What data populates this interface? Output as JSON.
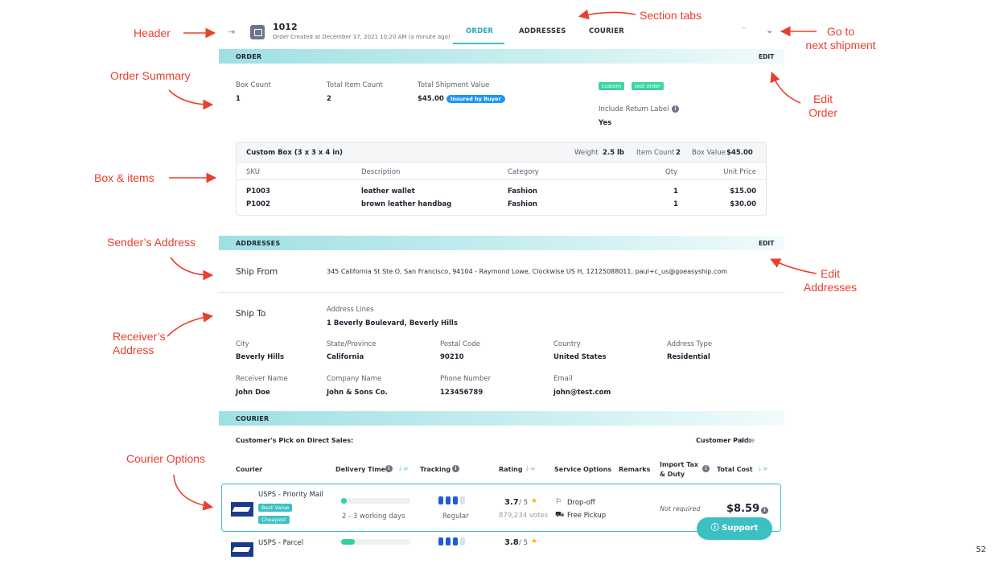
{
  "annotations": {
    "header": "Header",
    "section_tabs": "Section tabs",
    "go_next": [
      "Go to",
      "next shipment"
    ],
    "order_summary": "Order Summary",
    "edit_order": [
      "Edit",
      "Order"
    ],
    "box_items": "Box & items",
    "sender_address": "Sender’s Address",
    "edit_addresses": [
      "Edit",
      "Addresses"
    ],
    "receiver_address": [
      "Receiver’s",
      "Address"
    ],
    "courier_options": "Courier Options"
  },
  "header": {
    "collapse_icon": "collapse-icon",
    "box_icon": "box-icon",
    "shipment_id": "1012",
    "created": "Order Created at December 17, 2021 10:20 AM (a minute ago)",
    "tabs": [
      "ORDER",
      "ADDRESSES",
      "COURIER"
    ],
    "active_tab": "ORDER",
    "prev_icon": "chevron-up-icon",
    "next_icon": "chevron-down-icon"
  },
  "order": {
    "section_title": "ORDER",
    "edit_label": "EDIT",
    "box_count_label": "Box Count",
    "box_count": "1",
    "total_item_count_label": "Total Item Count",
    "total_item_count": "2",
    "total_value_label": "Total Shipment Value",
    "total_value": "$45.00",
    "insured_badge": "Insured by Buyer",
    "tags": [
      "custom",
      "test order"
    ],
    "return_label_label": "Include Return Label",
    "return_label": "Yes",
    "box": {
      "name": "Custom Box (3 x 3 x 4 in)",
      "weight_label": "Weight",
      "weight": "2.5 lb",
      "item_count_label": "Item Count",
      "item_count": "2",
      "box_value_label": "Box Value",
      "box_value": "$45.00",
      "columns": [
        "SKU",
        "Description",
        "Category",
        "Qty",
        "Unit Price"
      ],
      "rows": [
        [
          "P1003",
          "leather wallet",
          "Fashion",
          "1",
          "$15.00"
        ],
        [
          "P1002",
          "brown leather handbag",
          "Fashion",
          "1",
          "$30.00"
        ]
      ]
    }
  },
  "addresses": {
    "section_title": "ADDRESSES",
    "edit_label": "EDIT",
    "ship_from_label": "Ship From",
    "ship_from": "345 California St Ste O, San Francisco, 94104 - Raymond Lowe, Clockwise US H, 12125088011, paul+c_us@goeasyship.com",
    "ship_to_label": "Ship To",
    "address_lines_label": "Address Lines",
    "address_lines": "1 Beverly Boulevard, Beverly Hills",
    "fields": [
      {
        "label": "City",
        "value": "Beverly Hills"
      },
      {
        "label": "State/Province",
        "value": "California"
      },
      {
        "label": "Postal Code",
        "value": "90210"
      },
      {
        "label": "Country",
        "value": "United States"
      },
      {
        "label": "Address Type",
        "value": "Residential"
      },
      {
        "label": "Receiver Name",
        "value": "John Doe"
      },
      {
        "label": "Company Name",
        "value": "John & Sons Co."
      },
      {
        "label": "Phone Number",
        "value": "123456789"
      },
      {
        "label": "Email",
        "value": "john@test.com"
      }
    ]
  },
  "courier": {
    "section_title": "COURIER",
    "pick_label": "Customer's Pick on Direct Sales:",
    "paid_label": "Customer Paid:",
    "paid_value": "Free",
    "columns": {
      "courier": "Courier",
      "delivery_time": "Delivery Time",
      "tracking": "Tracking",
      "rating": "Rating",
      "service_options": "Service Options",
      "remarks": "Remarks",
      "import_tax_1": "Import Tax",
      "import_tax_2": "& Duty",
      "total_cost": "Total Cost"
    },
    "options": [
      {
        "name": "USPS - Priority Mail",
        "tags": [
          "Best Value",
          "Cheapest"
        ],
        "delivery": "2 - 3 working days",
        "delivery_fraction": 0.08,
        "tracking": "Regular",
        "tracking_level": 3,
        "rating": "3.7",
        "rating_max": "/ 5",
        "votes": "879,234 votes",
        "services": [
          "Drop-off",
          "Free Pickup"
        ],
        "import_tax": "Not required",
        "total": "$8.59"
      },
      {
        "name": "USPS - Parcel",
        "delivery_fraction": 0.2,
        "tracking_level": 3,
        "rating": "3.8",
        "rating_max": "/ 5"
      }
    ],
    "support_label": "Support",
    "support_icon": "help-circle-icon"
  },
  "colors": {
    "accent": "#3cc0c4",
    "annotation": "#e8402e",
    "badge_blue": "#2196f3",
    "tag_green": "#3dd6a4",
    "usps_blue": "#1b3c8c"
  },
  "page_number": "52"
}
